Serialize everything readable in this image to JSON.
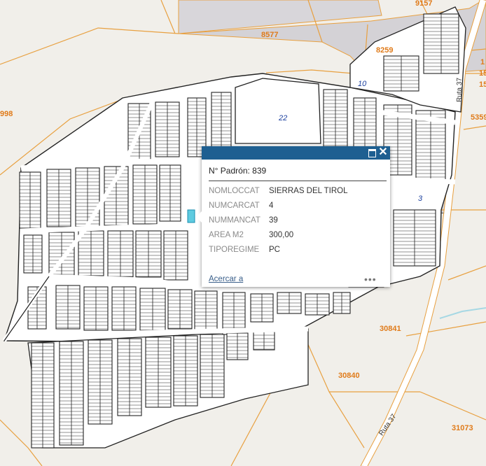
{
  "map": {
    "parcel_labels": [
      "9157",
      "8577",
      "8259",
      "1",
      "15",
      "15",
      "5359",
      "998",
      "30841",
      "30840",
      "31073"
    ],
    "block_labels": [
      "10",
      "22",
      "3"
    ],
    "road_label": "Ruta 37",
    "road_label_short": "Ruta 37",
    "highlight_color": "#5ecbe0",
    "parcel_line_color": "#e8a040",
    "label_color": "#e07b1a",
    "block_label_color": "#1b3f9e"
  },
  "popup": {
    "title": "N° Padrón: 839",
    "attributes": [
      {
        "key": "NOMLOCCAT",
        "value": "SIERRAS DEL TIROL"
      },
      {
        "key": "NUMCARCAT",
        "value": "4"
      },
      {
        "key": "NUMMANCAT",
        "value": "39"
      },
      {
        "key": "AREA M2",
        "value": "300,00"
      },
      {
        "key": "TIPOREGIME",
        "value": "PC"
      }
    ],
    "zoom_label": "Acercar a",
    "more_label": "•••",
    "maximize_icon": "maximize-icon",
    "close_icon": "close-icon",
    "header_color": "#1e5f91"
  }
}
